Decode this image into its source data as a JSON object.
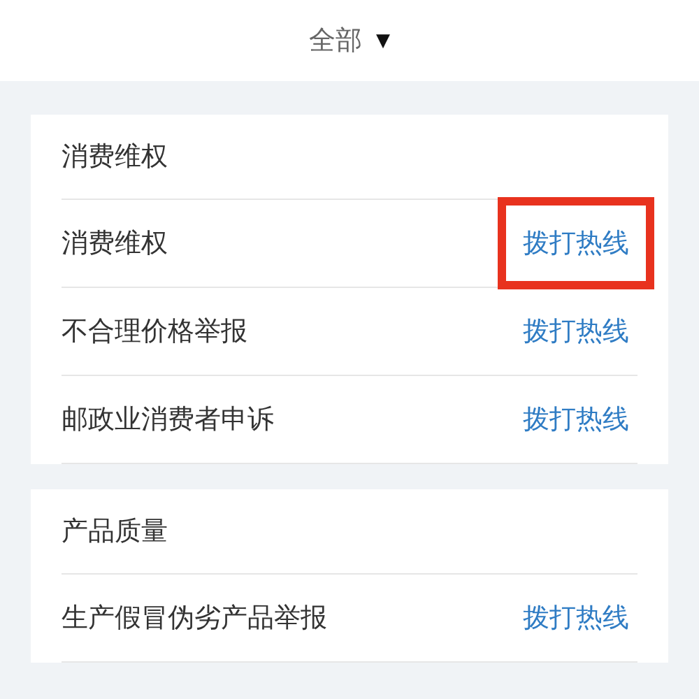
{
  "filter": {
    "label": "全部",
    "arrow": "▼"
  },
  "sections": [
    {
      "title": "消费维权",
      "rows": [
        {
          "name": "消费维权",
          "action": "拨打热线",
          "highlighted": true
        },
        {
          "name": "不合理价格举报",
          "action": "拨打热线",
          "highlighted": false
        },
        {
          "name": "邮政业消费者申诉",
          "action": "拨打热线",
          "highlighted": false
        }
      ]
    },
    {
      "title": "产品质量",
      "rows": [
        {
          "name": "生产假冒伪劣产品举报",
          "action": "拨打热线",
          "highlighted": false
        }
      ]
    }
  ]
}
